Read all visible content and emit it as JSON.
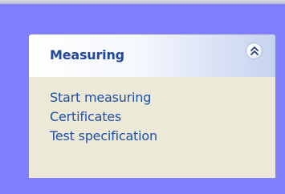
{
  "panel": {
    "title": "Measuring",
    "collapse_icon": "chevron-double-up-icon",
    "links": [
      {
        "label": "Start measuring"
      },
      {
        "label": "Certificates"
      },
      {
        "label": "Test specification"
      }
    ]
  },
  "colors": {
    "background": "#8080ff",
    "header_start": "#ffffff",
    "header_end": "#c6d2ef",
    "body": "#ece9d8",
    "title_text": "#21489c",
    "link_text": "#1f4fa6"
  }
}
